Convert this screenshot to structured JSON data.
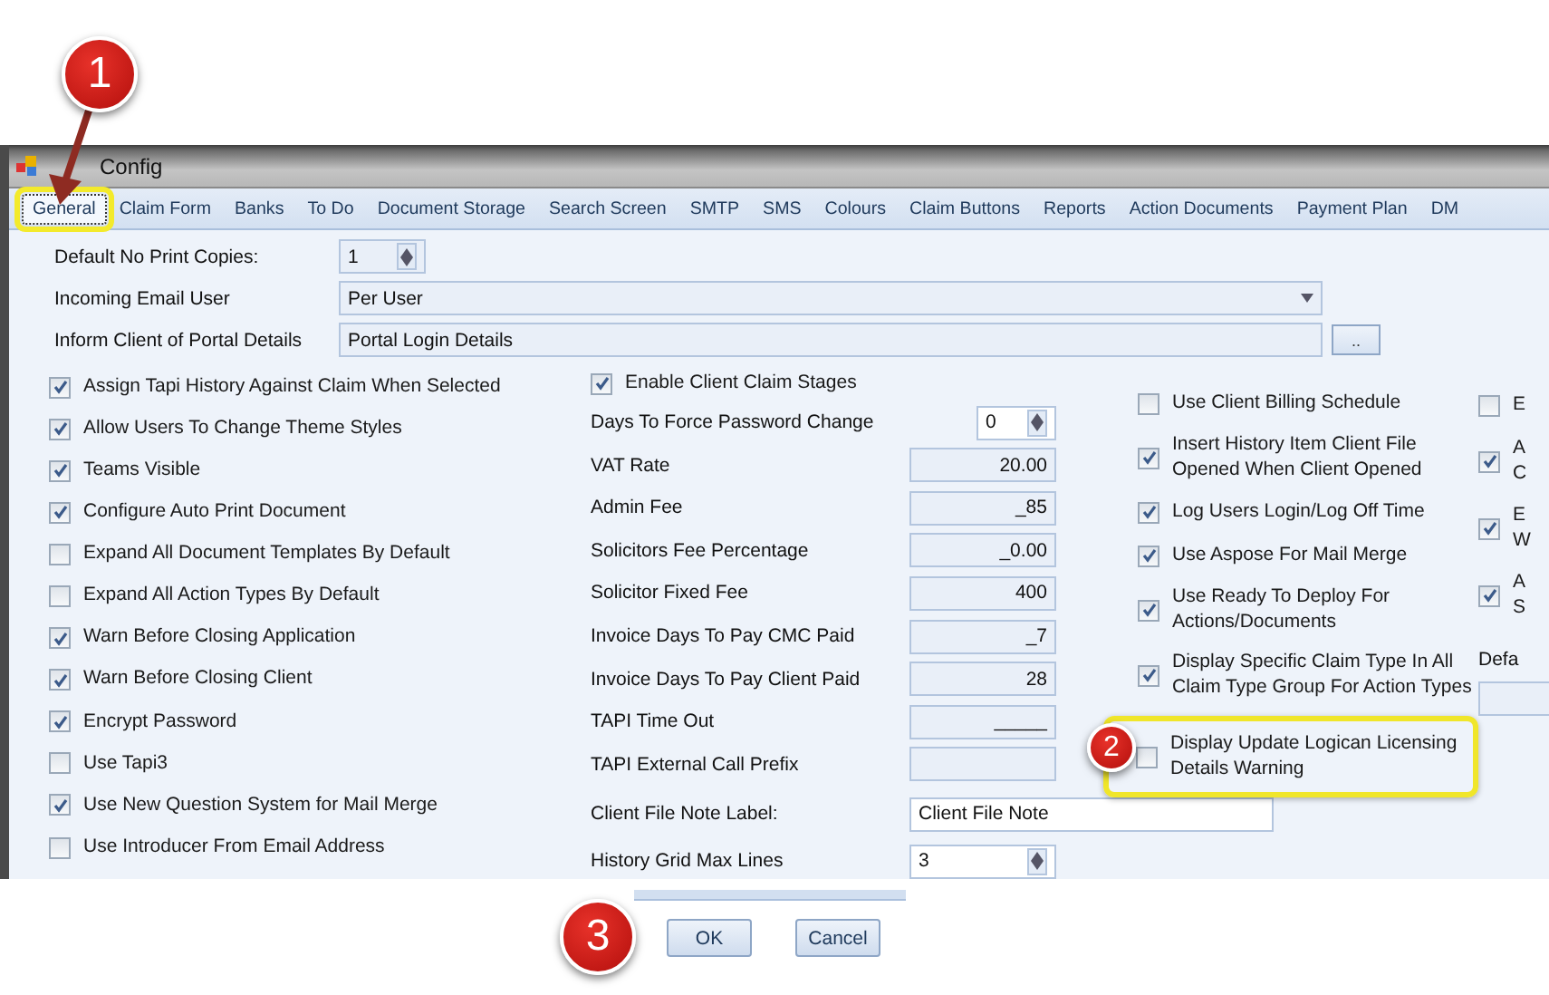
{
  "window": {
    "title": "Config"
  },
  "tabs": [
    {
      "label": "General",
      "selected": true,
      "highlighted": true
    },
    {
      "label": "Claim Form",
      "selected": false,
      "highlighted": false
    },
    {
      "label": "Banks",
      "selected": false,
      "highlighted": false
    },
    {
      "label": "To Do",
      "selected": false,
      "highlighted": false
    },
    {
      "label": "Document Storage",
      "selected": false,
      "highlighted": false
    },
    {
      "label": "Search Screen",
      "selected": false,
      "highlighted": false
    },
    {
      "label": "SMTP",
      "selected": false,
      "highlighted": false
    },
    {
      "label": "SMS",
      "selected": false,
      "highlighted": false
    },
    {
      "label": "Colours",
      "selected": false,
      "highlighted": false
    },
    {
      "label": "Claim Buttons",
      "selected": false,
      "highlighted": false
    },
    {
      "label": "Reports",
      "selected": false,
      "highlighted": false
    },
    {
      "label": "Action Documents",
      "selected": false,
      "highlighted": false
    },
    {
      "label": "Payment Plan",
      "selected": false,
      "highlighted": false
    },
    {
      "label": "DM",
      "selected": false,
      "highlighted": false
    }
  ],
  "top_fields": [
    {
      "kind": "spinner",
      "label": "Default No Print Copies:",
      "value": "1"
    },
    {
      "kind": "combo",
      "label": "Incoming Email User",
      "value": "Per User"
    },
    {
      "kind": "browse",
      "label": "Inform Client of Portal Details",
      "value": "Portal Login Details",
      "button": ".."
    }
  ],
  "column_1": [
    {
      "label": "Assign Tapi History Against Claim When Selected",
      "checked": true
    },
    {
      "label": "Allow Users To Change Theme Styles",
      "checked": true
    },
    {
      "label": "Teams Visible",
      "checked": true
    },
    {
      "label": "Configure Auto Print Document",
      "checked": true
    },
    {
      "label": "Expand All Document Templates By Default",
      "checked": false
    },
    {
      "label": "Expand All Action Types By Default",
      "checked": false
    },
    {
      "label": "Warn Before Closing Application",
      "checked": true
    },
    {
      "label": "Warn Before Closing Client",
      "checked": true
    },
    {
      "label": "Encrypt Password",
      "checked": true
    },
    {
      "label": "Use Tapi3",
      "checked": false
    },
    {
      "label": "Use New Question System for Mail Merge",
      "checked": true
    },
    {
      "label": "Use Introducer From Email Address",
      "checked": false
    }
  ],
  "column_2": [
    {
      "kind": "checkbox",
      "label": "Enable Client Claim Stages",
      "checked": true
    },
    {
      "kind": "spinner",
      "label": "Days To Force Password Change",
      "value": "0"
    },
    {
      "kind": "number",
      "label": "VAT Rate",
      "value": "20.00"
    },
    {
      "kind": "number",
      "label": "Admin Fee",
      "value": "_85"
    },
    {
      "kind": "number",
      "label": "Solicitors Fee Percentage",
      "value": "_0.00"
    },
    {
      "kind": "number",
      "label": "Solicitor Fixed Fee",
      "value": "400"
    },
    {
      "kind": "number",
      "label": "Invoice Days To Pay CMC Paid",
      "value": "_7"
    },
    {
      "kind": "number",
      "label": "Invoice Days To Pay Client Paid",
      "value": "28"
    },
    {
      "kind": "number",
      "label": "TAPI Time Out",
      "value": "_____"
    },
    {
      "kind": "number",
      "label": "TAPI External Call Prefix"
    },
    {
      "kind": "text",
      "label": "Client File Note Label:",
      "value": "Client File Note"
    },
    {
      "kind": "white-spinner",
      "label": "History Grid Max Lines",
      "value": "3"
    }
  ],
  "column_3": [
    {
      "label": "Use Client Billing Schedule",
      "checked": false,
      "highlighted": false
    },
    {
      "label": "Insert History Item Client File\nOpened When Client Opened",
      "checked": true,
      "highlighted": false
    },
    {
      "label": "Log Users Login/Log Off Time",
      "checked": true,
      "highlighted": false
    },
    {
      "label": "Use Aspose For Mail Merge",
      "checked": true,
      "highlighted": false
    },
    {
      "label": "Use Ready To Deploy For\nActions/Documents",
      "checked": true,
      "highlighted": false
    },
    {
      "label": "Display Specific Claim Type In All\nClaim Type Group For Action Types",
      "checked": true,
      "highlighted": false
    },
    {
      "label": "Display Update Logican Licensing\nDetails Warning",
      "checked": false,
      "highlighted": true
    }
  ],
  "column_4": [
    {
      "kind": "checkbox",
      "label": "E",
      "checked": false
    },
    {
      "kind": "checkbox",
      "label": "A\nC",
      "checked": true
    },
    {
      "kind": "checkbox",
      "label": "E\nW",
      "checked": true
    },
    {
      "kind": "checkbox",
      "label": "A\nS",
      "checked": true
    },
    {
      "kind": "label",
      "label": "Defa"
    },
    {
      "kind": "field"
    }
  ],
  "buttons": [
    "OK",
    "Cancel"
  ],
  "callouts": [
    "1",
    "2",
    "3"
  ]
}
